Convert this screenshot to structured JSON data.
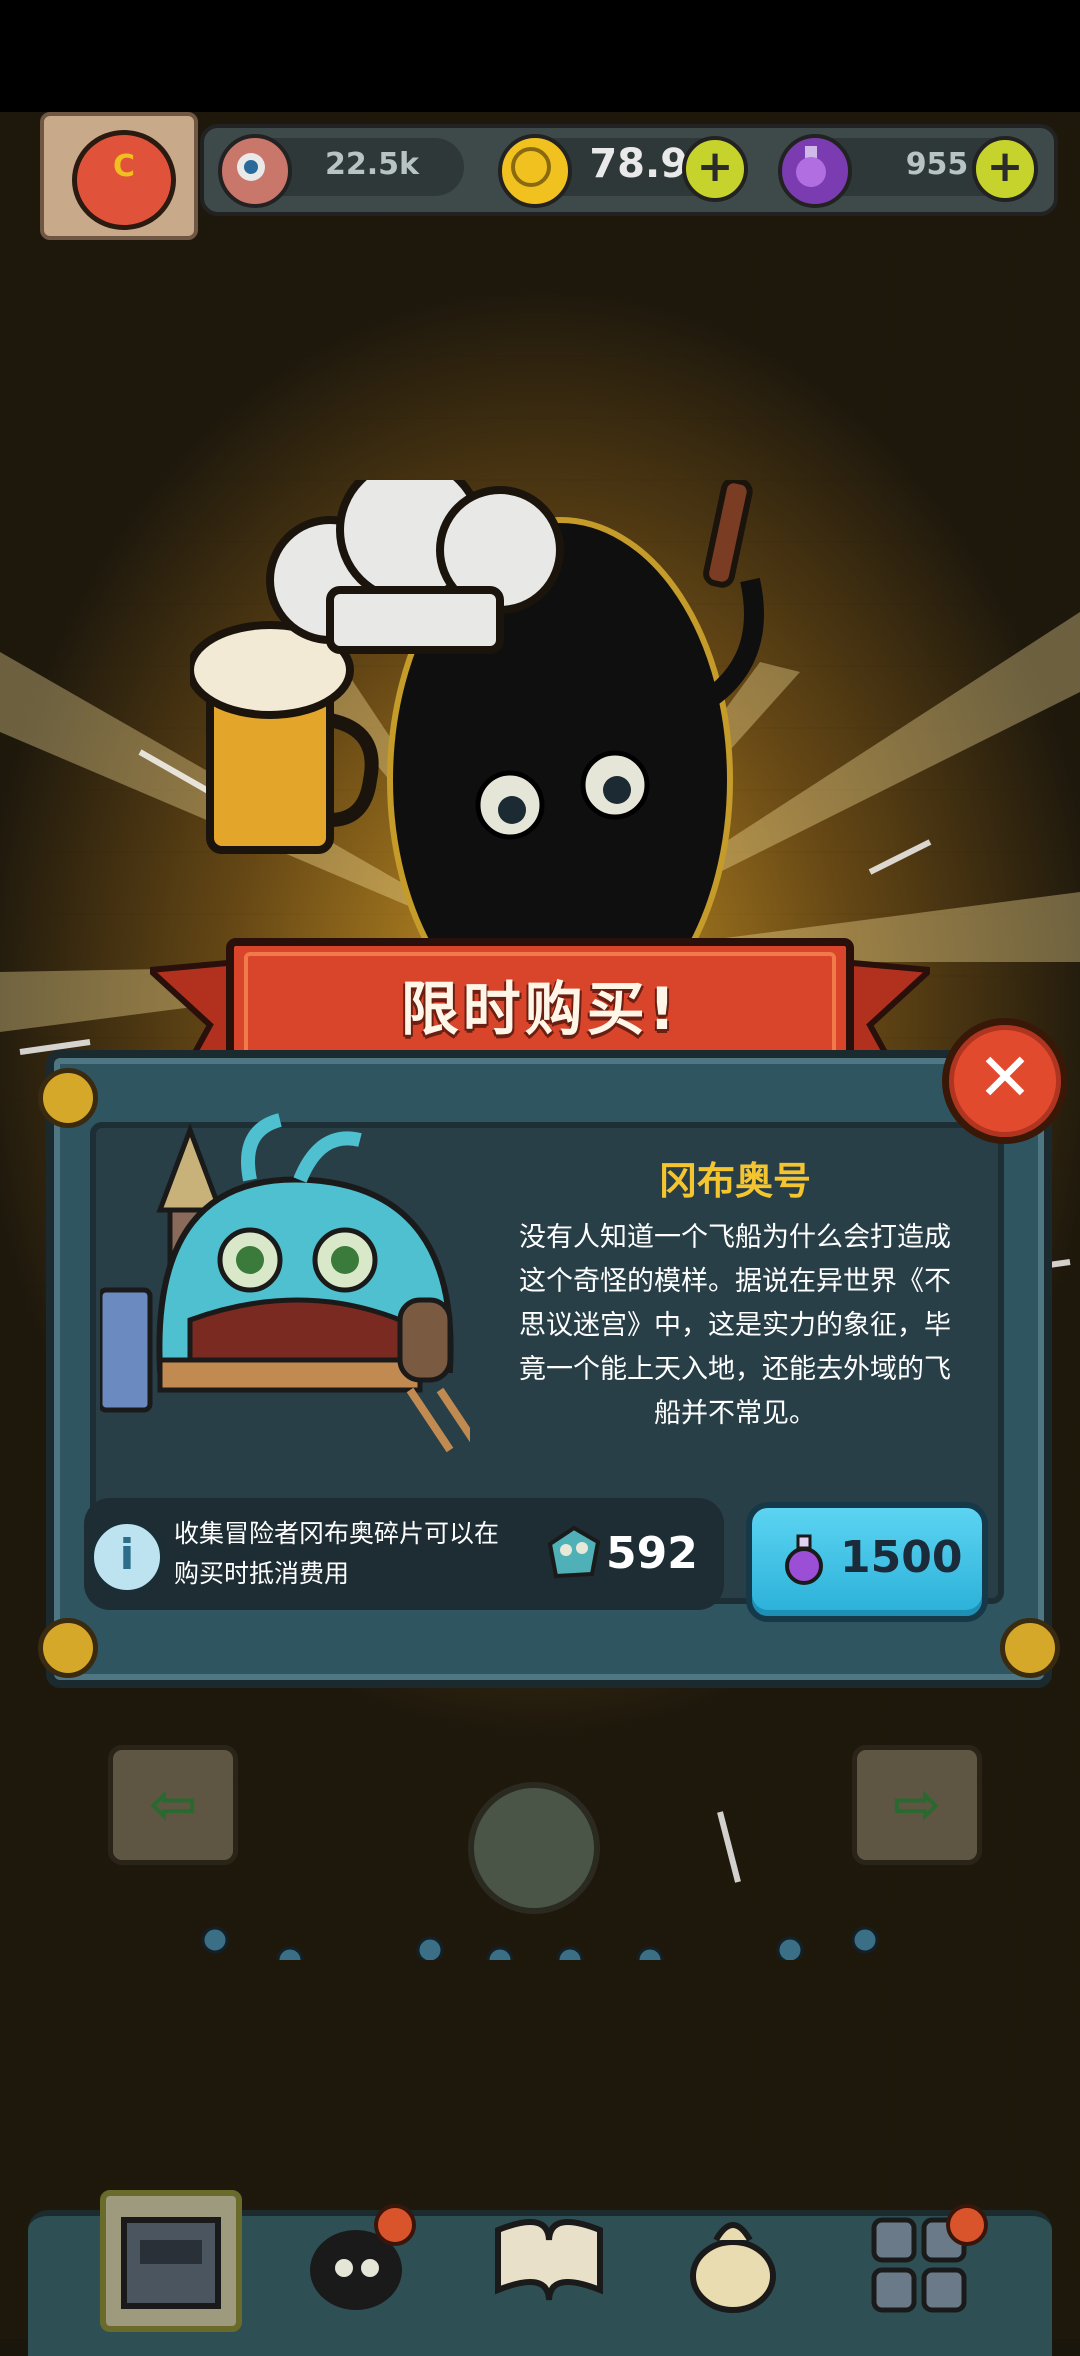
{
  "hud": {
    "eyes": "22.5k",
    "coins": "78.9k",
    "potions": "955",
    "plus_symbol": "+"
  },
  "avatar": {
    "letter": "C"
  },
  "offer": {
    "title": "限时购买!",
    "item_name": "冈布奥号",
    "desc_lines": [
      "没有人知道一个飞船为什么会打造成",
      "这个奇怪的模样。据说在异世界《不",
      "思议迷宫》中，这是实力的象征，毕",
      "竟一个能上天入地，还能去外域的飞",
      "船并不常见。"
    ],
    "info_lines": [
      "收集冒险者冈布奥碎片可以在",
      "购买时抵消费用"
    ],
    "info_symbol": "i",
    "fragments": "592",
    "price": "1500",
    "close_symbol": "✕"
  },
  "colors": {
    "accent_gold": "#f5c530",
    "ribbon_red": "#d8452b",
    "buy_blue": "#3fc2e6",
    "panel_teal": "#2f5560"
  },
  "icons": [
    "eye-icon",
    "coin-icon",
    "potion-icon",
    "info-icon",
    "fragment-icon",
    "close-icon"
  ]
}
